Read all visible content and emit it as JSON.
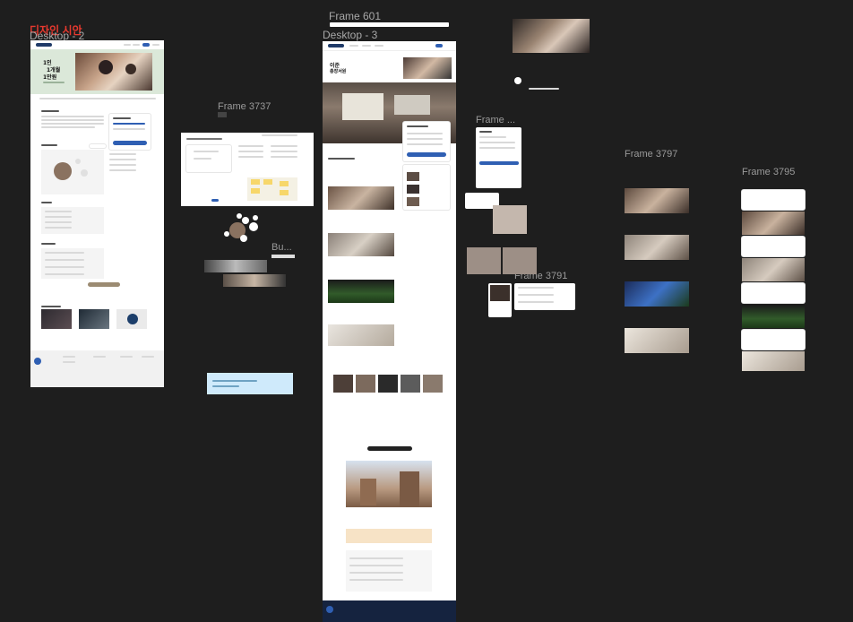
{
  "canvas": {
    "annotation_title": "디자인 시안",
    "frames": {
      "desktop2": "Desktop - 2",
      "desktop3": "Desktop - 3",
      "frame601": "Frame 601",
      "frame3737": "Frame 3737",
      "frame_small": "Frame ...",
      "frame3797": "Frame 3797",
      "frame3795": "Frame 3795",
      "frame3791": "Frame 3791",
      "frame_bu": "Bu..."
    }
  },
  "desktop2": {
    "hero_lines": [
      "1인",
      "1개월",
      "1만원"
    ]
  },
  "desktop3": {
    "hero_title": "이준",
    "hero_subtitle": "총장서원"
  },
  "colors": {
    "canvas_bg": "#1e1e1e",
    "annotation_red": "#e8392f",
    "brand_navy": "#1f3a68",
    "accent_blue": "#2f5fb3",
    "note_blue": "#cfeafb",
    "peach": "#f7e3c6"
  }
}
